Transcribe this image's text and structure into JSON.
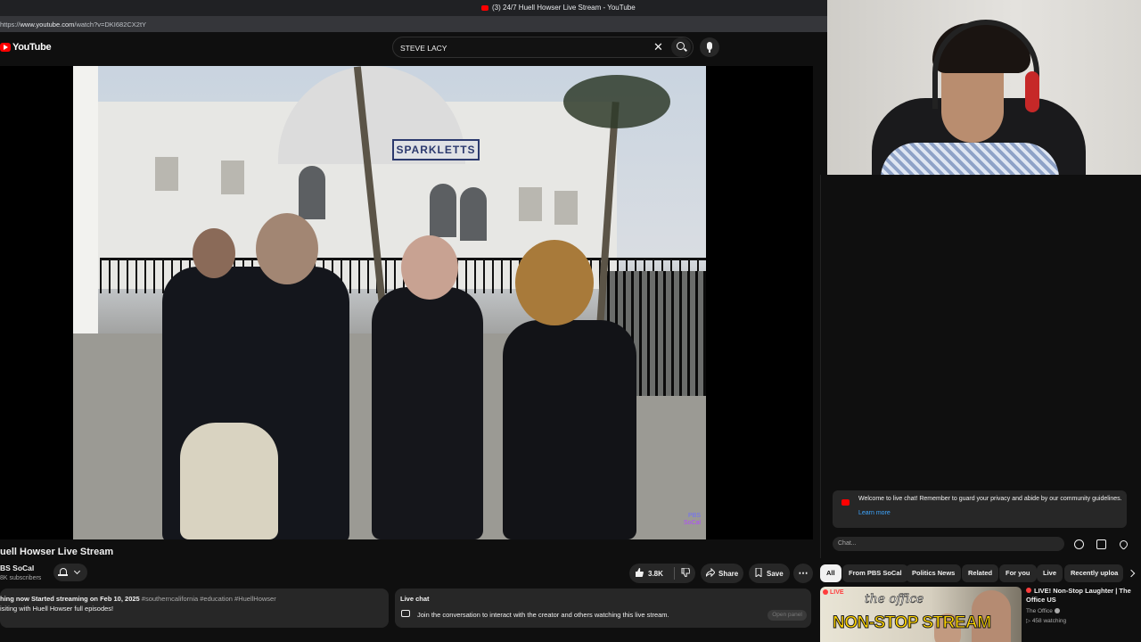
{
  "browser": {
    "tab_title": "(3) 24/7 Huell Howser Live Stream - YouTube",
    "url_prefix": "https://",
    "url_host": "www.youtube.com",
    "url_path": "/watch?v=DKI682CX2tY"
  },
  "header": {
    "logo_text": "YouTube",
    "search_value": "STEVE LACY"
  },
  "player": {
    "sign_text": "SPARKLETTS",
    "watermark_line1": "PBS",
    "watermark_line2": "SoCal"
  },
  "video": {
    "title": "uell Howser Live Stream",
    "channel": "BS SoCal",
    "subscribers": "8K subscribers",
    "like_count": "3.8K",
    "share_label": "Share",
    "save_label": "Save"
  },
  "description": {
    "line1": "hing now  Started streaming on Feb 10, 2025",
    "tags": " #southerncalifornia #education #HuellHowser",
    "line2": "isiting with Huell Howser full episodes!"
  },
  "live_chat_box": {
    "title": "Live chat",
    "message": "Join the conversation to interact with the creator and others watching this live stream.",
    "open_panel": "Open panel"
  },
  "chat": {
    "notice": "Welcome to live chat! Remember to guard your privacy and abide by our community guidelines.",
    "learn_more": "Learn more",
    "input_placeholder": "Chat..."
  },
  "chips": [
    "All",
    "From PBS SoCal",
    "Politics News",
    "Related",
    "For you",
    "Live",
    "Recently uploa"
  ],
  "recommendation": {
    "badge": "LIVE",
    "thumb_the": "the office",
    "thumb_big": "NON-STOP STREAM",
    "title": "LIVE! Non-Stop Laughter | The Office US",
    "channel": "The Office",
    "watching": "458 watching"
  },
  "colors": {
    "accent_red": "#ff0000",
    "link_blue": "#3ea6ff",
    "background": "#0f0f0f"
  }
}
